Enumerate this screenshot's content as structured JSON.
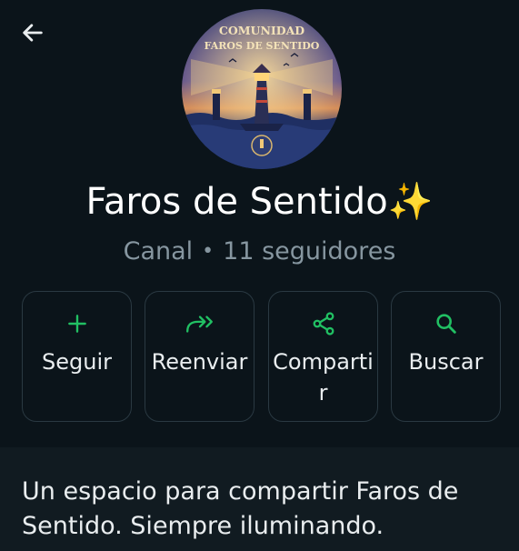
{
  "header": {
    "back_icon": "arrow-left-icon"
  },
  "avatar": {
    "line1": "COMUNIDAD",
    "line2": "FAROS DE SENTIDO"
  },
  "channel": {
    "name": "Faros de Sentido✨",
    "type": "Canal",
    "separator": "•",
    "followers": "11 seguidores"
  },
  "actions": [
    {
      "label": "Seguir",
      "icon": "plus-icon"
    },
    {
      "label": "Reenviar",
      "icon": "forward-icon"
    },
    {
      "label": "Compartir",
      "icon": "share-icon"
    },
    {
      "label": "Buscar",
      "icon": "search-icon"
    }
  ],
  "description": "Un espacio para compartir Faros de Sentido. Siempre iluminando.",
  "colors": {
    "background": "#0b141a",
    "accent": "#21c063",
    "muted_text": "#8696a0",
    "card_border": "#2a3942"
  }
}
